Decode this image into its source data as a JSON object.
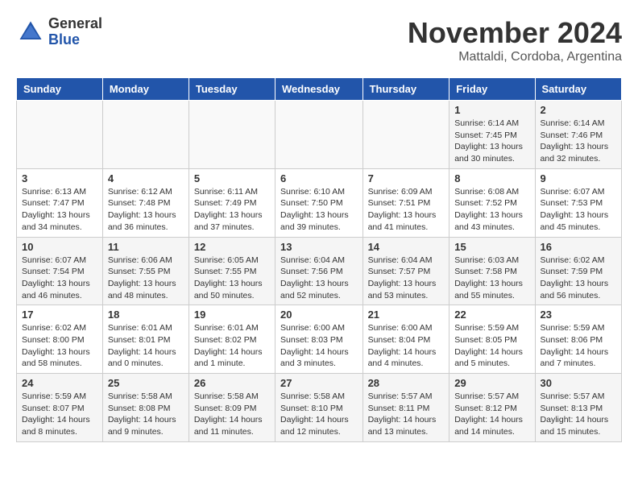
{
  "header": {
    "logo_general": "General",
    "logo_blue": "Blue",
    "month": "November 2024",
    "location": "Mattaldi, Cordoba, Argentina"
  },
  "weekdays": [
    "Sunday",
    "Monday",
    "Tuesday",
    "Wednesday",
    "Thursday",
    "Friday",
    "Saturday"
  ],
  "weeks": [
    [
      {
        "day": "",
        "info": ""
      },
      {
        "day": "",
        "info": ""
      },
      {
        "day": "",
        "info": ""
      },
      {
        "day": "",
        "info": ""
      },
      {
        "day": "",
        "info": ""
      },
      {
        "day": "1",
        "info": "Sunrise: 6:14 AM\nSunset: 7:45 PM\nDaylight: 13 hours and 30 minutes."
      },
      {
        "day": "2",
        "info": "Sunrise: 6:14 AM\nSunset: 7:46 PM\nDaylight: 13 hours and 32 minutes."
      }
    ],
    [
      {
        "day": "3",
        "info": "Sunrise: 6:13 AM\nSunset: 7:47 PM\nDaylight: 13 hours and 34 minutes."
      },
      {
        "day": "4",
        "info": "Sunrise: 6:12 AM\nSunset: 7:48 PM\nDaylight: 13 hours and 36 minutes."
      },
      {
        "day": "5",
        "info": "Sunrise: 6:11 AM\nSunset: 7:49 PM\nDaylight: 13 hours and 37 minutes."
      },
      {
        "day": "6",
        "info": "Sunrise: 6:10 AM\nSunset: 7:50 PM\nDaylight: 13 hours and 39 minutes."
      },
      {
        "day": "7",
        "info": "Sunrise: 6:09 AM\nSunset: 7:51 PM\nDaylight: 13 hours and 41 minutes."
      },
      {
        "day": "8",
        "info": "Sunrise: 6:08 AM\nSunset: 7:52 PM\nDaylight: 13 hours and 43 minutes."
      },
      {
        "day": "9",
        "info": "Sunrise: 6:07 AM\nSunset: 7:53 PM\nDaylight: 13 hours and 45 minutes."
      }
    ],
    [
      {
        "day": "10",
        "info": "Sunrise: 6:07 AM\nSunset: 7:54 PM\nDaylight: 13 hours and 46 minutes."
      },
      {
        "day": "11",
        "info": "Sunrise: 6:06 AM\nSunset: 7:55 PM\nDaylight: 13 hours and 48 minutes."
      },
      {
        "day": "12",
        "info": "Sunrise: 6:05 AM\nSunset: 7:55 PM\nDaylight: 13 hours and 50 minutes."
      },
      {
        "day": "13",
        "info": "Sunrise: 6:04 AM\nSunset: 7:56 PM\nDaylight: 13 hours and 52 minutes."
      },
      {
        "day": "14",
        "info": "Sunrise: 6:04 AM\nSunset: 7:57 PM\nDaylight: 13 hours and 53 minutes."
      },
      {
        "day": "15",
        "info": "Sunrise: 6:03 AM\nSunset: 7:58 PM\nDaylight: 13 hours and 55 minutes."
      },
      {
        "day": "16",
        "info": "Sunrise: 6:02 AM\nSunset: 7:59 PM\nDaylight: 13 hours and 56 minutes."
      }
    ],
    [
      {
        "day": "17",
        "info": "Sunrise: 6:02 AM\nSunset: 8:00 PM\nDaylight: 13 hours and 58 minutes."
      },
      {
        "day": "18",
        "info": "Sunrise: 6:01 AM\nSunset: 8:01 PM\nDaylight: 14 hours and 0 minutes."
      },
      {
        "day": "19",
        "info": "Sunrise: 6:01 AM\nSunset: 8:02 PM\nDaylight: 14 hours and 1 minute."
      },
      {
        "day": "20",
        "info": "Sunrise: 6:00 AM\nSunset: 8:03 PM\nDaylight: 14 hours and 3 minutes."
      },
      {
        "day": "21",
        "info": "Sunrise: 6:00 AM\nSunset: 8:04 PM\nDaylight: 14 hours and 4 minutes."
      },
      {
        "day": "22",
        "info": "Sunrise: 5:59 AM\nSunset: 8:05 PM\nDaylight: 14 hours and 5 minutes."
      },
      {
        "day": "23",
        "info": "Sunrise: 5:59 AM\nSunset: 8:06 PM\nDaylight: 14 hours and 7 minutes."
      }
    ],
    [
      {
        "day": "24",
        "info": "Sunrise: 5:59 AM\nSunset: 8:07 PM\nDaylight: 14 hours and 8 minutes."
      },
      {
        "day": "25",
        "info": "Sunrise: 5:58 AM\nSunset: 8:08 PM\nDaylight: 14 hours and 9 minutes."
      },
      {
        "day": "26",
        "info": "Sunrise: 5:58 AM\nSunset: 8:09 PM\nDaylight: 14 hours and 11 minutes."
      },
      {
        "day": "27",
        "info": "Sunrise: 5:58 AM\nSunset: 8:10 PM\nDaylight: 14 hours and 12 minutes."
      },
      {
        "day": "28",
        "info": "Sunrise: 5:57 AM\nSunset: 8:11 PM\nDaylight: 14 hours and 13 minutes."
      },
      {
        "day": "29",
        "info": "Sunrise: 5:57 AM\nSunset: 8:12 PM\nDaylight: 14 hours and 14 minutes."
      },
      {
        "day": "30",
        "info": "Sunrise: 5:57 AM\nSunset: 8:13 PM\nDaylight: 14 hours and 15 minutes."
      }
    ]
  ]
}
